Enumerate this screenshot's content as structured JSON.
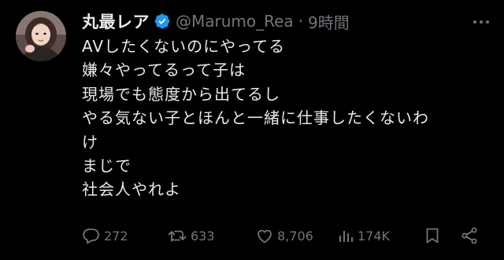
{
  "tweet": {
    "author": {
      "display_name": "丸最レア",
      "handle": "@Marumo_Rea",
      "verified": true,
      "avatar_icon": "avatar-photo"
    },
    "separator": "·",
    "time": "9時間",
    "lines": [
      "AVしたくないのにやってる",
      "嫌々やってるって子は",
      "現場でも態度から出てるし",
      "やる気ない子とほんと一緒に仕事したくないわ",
      "け",
      "まじで",
      "社会人やれよ"
    ],
    "stats": {
      "replies": "272",
      "retweets": "633",
      "likes": "8,706",
      "views": "174K"
    },
    "icons": {
      "verified": "verified-badge-icon",
      "more": "more-icon",
      "reply": "reply-icon",
      "retweet": "retweet-icon",
      "like": "heart-icon",
      "views": "views-icon",
      "bookmark": "bookmark-icon",
      "share": "share-icon"
    },
    "colors": {
      "background": "#000000",
      "text": "#e7e9ea",
      "muted": "#71767b",
      "verified": "#1d9bf0"
    }
  }
}
